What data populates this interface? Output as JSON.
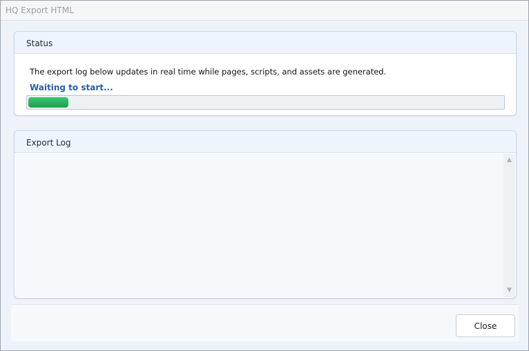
{
  "window": {
    "title": "HQ Export HTML"
  },
  "status_panel": {
    "title": "Status",
    "description": "The export log below updates in real time while pages, scripts, and assets are generated.",
    "state_text": "Waiting to start...",
    "progress_percent": 8.5,
    "progress_color": "#22a654"
  },
  "log_panel": {
    "title": "Export Log",
    "entries": [],
    "scroll_up_icon": "chevron-up-icon",
    "scroll_down_icon": "chevron-down-icon"
  },
  "footer": {
    "close_label": "Close"
  },
  "colors": {
    "accent_text": "#2a5ea8",
    "panel_header": "#edf4fc"
  }
}
